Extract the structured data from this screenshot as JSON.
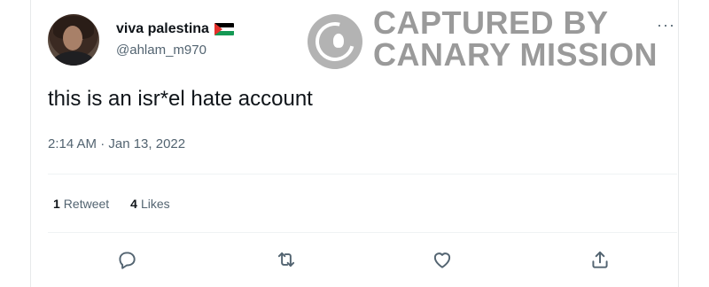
{
  "user": {
    "display_name": "viva palestina",
    "flag_icon": "palestine-flag-icon",
    "handle": "@ahlam_m970"
  },
  "watermark": {
    "line1": "CAPTURED BY",
    "line2": "CANARY MISSION",
    "color": "#9a9a9a"
  },
  "more_menu": "···",
  "tweet": {
    "text": "this is an isr*el hate account",
    "timestamp": "2:14 AM · Jan 13, 2022"
  },
  "stats": {
    "retweets_count": "1",
    "retweets_label": "Retweet",
    "likes_count": "4",
    "likes_label": "Likes"
  },
  "actions": [
    "reply-icon",
    "retweet-icon",
    "like-icon",
    "share-icon"
  ],
  "colors": {
    "text_primary": "#0f1419",
    "text_secondary": "#536471",
    "divider": "#eff3f4"
  }
}
